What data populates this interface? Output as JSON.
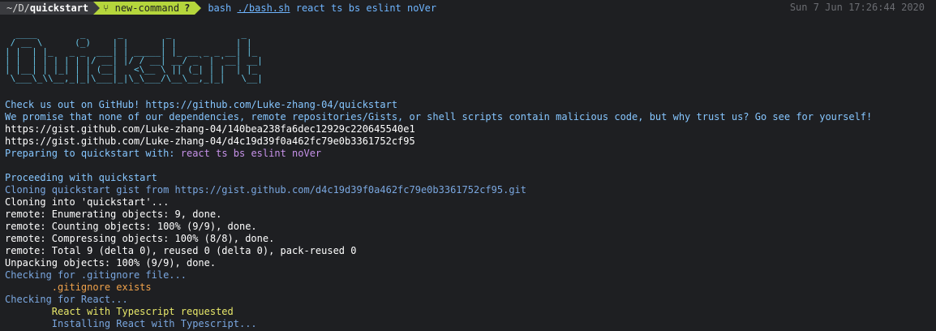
{
  "prompt": {
    "dir_prefix": "~/D/",
    "dir_name": "quickstart",
    "git_branch": "new-command",
    "git_status": "?",
    "command_name": "bash",
    "command_path": "./bash.sh",
    "command_args": "react ts bs eslint noVer",
    "clock": "Sun  7 Jun 17:26:44 2020"
  },
  "banner": {
    "ascii": "  ____        _      _        _             _   \n / __ \\      (_)    | |      | |           | |  \n| |  | |_   _ _  ___| | _____| |_ __ _ _ __| |_ \n| |  | | | | | |/ __| |/ / __| __/ _` | '__| __|\n| |__| | |_| | | (__|   <\\__ \\ || (_| | |  | |_ \n \\___\\_\\\\__,_|_|\\___|_|\\_\\___/\\__\\__,_|_|   \\__|"
  },
  "output": [
    {
      "text": "Check us out on GitHub! https://github.com/Luke-zhang-04/quickstart",
      "color": "cyan"
    },
    {
      "text": "We promise that none of our dependencies, remote repositories/Gists, or shell scripts contain malicious code, but why trust us? Go see for yourself!",
      "color": "cyan"
    },
    {
      "text": "https://gist.github.com/Luke-zhang-04/140bea238fa6dec12929c220645540e1",
      "color": "white"
    },
    {
      "text": "https://gist.github.com/Luke-zhang-04/d4c19d39f0a462fc79e0b3361752cf95",
      "color": "white"
    },
    {
      "text": "Preparing to quickstart with: ",
      "color": "cyan",
      "suffix": "react ts bs eslint noVer",
      "suffix_color": "purple"
    },
    {
      "text": "",
      "color": "white"
    },
    {
      "text": "Proceeding with quickstart",
      "color": "cyan"
    },
    {
      "text": "Cloning quickstart gist from https://gist.github.com/d4c19d39f0a462fc79e0b3361752cf95.git",
      "color": "steel"
    },
    {
      "text": "Cloning into 'quickstart'...",
      "color": "white"
    },
    {
      "text": "remote: Enumerating objects: 9, done.",
      "color": "white"
    },
    {
      "text": "remote: Counting objects: 100% (9/9), done.",
      "color": "white"
    },
    {
      "text": "remote: Compressing objects: 100% (8/8), done.",
      "color": "white"
    },
    {
      "text": "remote: Total 9 (delta 0), reused 0 (delta 0), pack-reused 0",
      "color": "white"
    },
    {
      "text": "Unpacking objects: 100% (9/9), done.",
      "color": "white"
    },
    {
      "text": "Checking for .gitignore file...",
      "color": "steel"
    },
    {
      "text": "        .gitignore exists",
      "color": "orange"
    },
    {
      "text": "Checking for React...",
      "color": "steel"
    },
    {
      "text": "        React with Typescript requested",
      "color": "yellow"
    },
    {
      "text": "        Installing React with Typescript...",
      "color": "steel"
    }
  ]
}
